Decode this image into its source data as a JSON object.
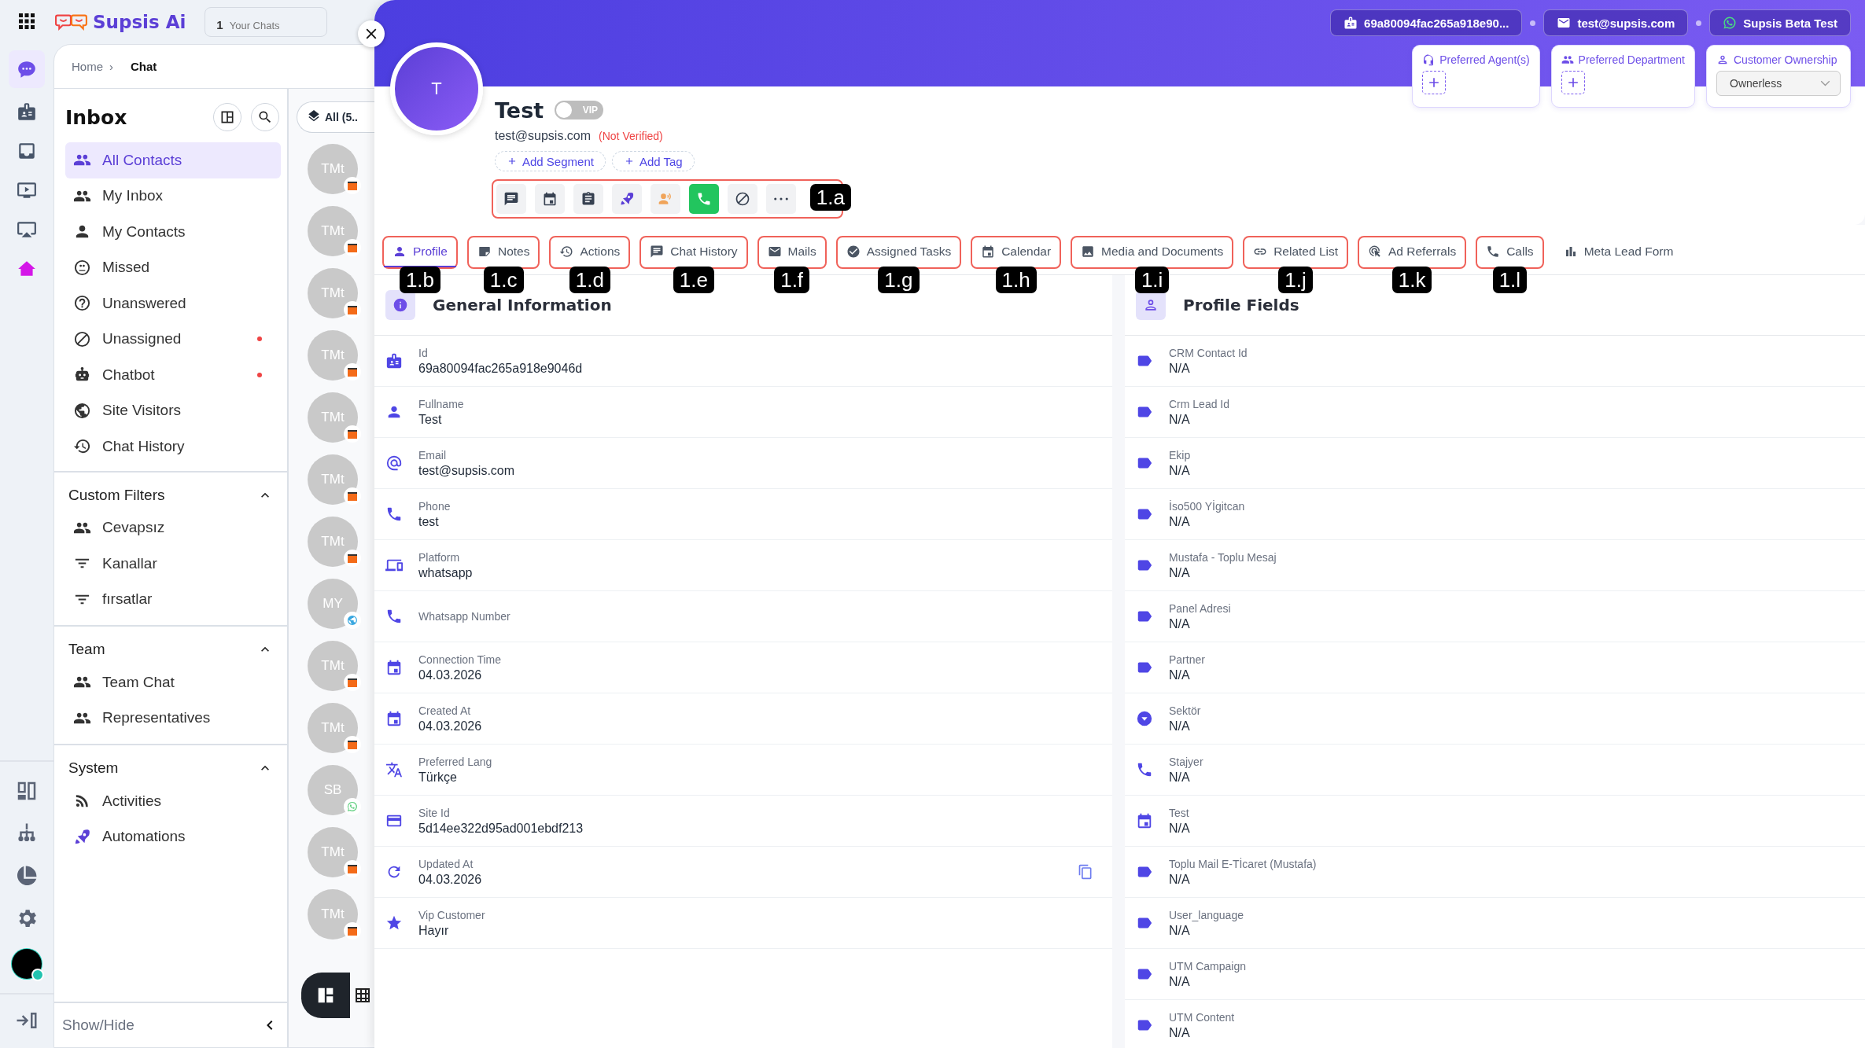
{
  "app": {
    "brand": "Supsis Ai",
    "chats_count": "1",
    "chats_label": "Your Chats"
  },
  "rail": [
    {
      "selected": true
    },
    {
      "selected": false
    },
    {
      "selected": false
    },
    {
      "selected": false
    },
    {
      "selected": false
    },
    {
      "selected": false
    }
  ],
  "user": {
    "online": true
  },
  "breadcrumb": {
    "home": "Home",
    "separator": "›",
    "current": "Chat"
  },
  "inbox": {
    "title": "Inbox",
    "items": [
      {
        "label": "All Contacts",
        "selected": true,
        "alert": false
      },
      {
        "label": "My Inbox",
        "selected": false,
        "alert": false
      },
      {
        "label": "My Contacts",
        "selected": false,
        "alert": false
      },
      {
        "label": "Missed",
        "selected": false,
        "alert": false
      },
      {
        "label": "Unanswered",
        "selected": false,
        "alert": false
      },
      {
        "label": "Unassigned",
        "selected": false,
        "alert": true
      },
      {
        "label": "Chatbot",
        "selected": false,
        "alert": true
      },
      {
        "label": "Site Visitors",
        "selected": false,
        "alert": false
      },
      {
        "label": "Chat History",
        "selected": false,
        "alert": false
      }
    ],
    "sections": [
      {
        "title": "Custom Filters",
        "expanded": true,
        "items": [
          "Cevapsız",
          "Kanallar",
          "fırsatlar"
        ]
      },
      {
        "title": "Team",
        "expanded": true,
        "items": [
          "Team Chat",
          "Representatives"
        ]
      },
      {
        "title": "System",
        "expanded": true,
        "items": [
          "Activities",
          "Automations"
        ]
      }
    ],
    "footer": "Show/Hide"
  },
  "chat_list": {
    "filter": "All (5..",
    "avatars": [
      {
        "initials": "TMt",
        "kind": "shop"
      },
      {
        "initials": "TMt",
        "kind": "shop"
      },
      {
        "initials": "TMt",
        "kind": "shop"
      },
      {
        "initials": "TMt",
        "kind": "shop"
      },
      {
        "initials": "TMt",
        "kind": "shop"
      },
      {
        "initials": "TMt",
        "kind": "shop"
      },
      {
        "initials": "TMt",
        "kind": "shop"
      },
      {
        "initials": "MY",
        "kind": "web"
      },
      {
        "initials": "TMt",
        "kind": "shop"
      },
      {
        "initials": "TMt",
        "kind": "shop"
      },
      {
        "initials": "SB",
        "kind": "whatsapp"
      },
      {
        "initials": "TMt",
        "kind": "shop"
      },
      {
        "initials": "TMt",
        "kind": "shop"
      }
    ]
  },
  "contact": {
    "avatar": "T",
    "name": "Test",
    "vip": false,
    "vip_label": "VIP",
    "email": "test@supsis.com",
    "verification": "(Not Verified)",
    "add_buttons": [
      "Add Segment",
      "Add Tag"
    ],
    "actions_callout": "1.a",
    "actions": [
      {
        "highlighted": false
      },
      {
        "highlighted": false
      },
      {
        "highlighted": false
      },
      {
        "highlighted": false
      },
      {
        "highlighted": false
      },
      {
        "highlighted": true
      },
      {
        "highlighted": false
      },
      {
        "highlighted": false
      }
    ],
    "chips": [
      "69a80094fac265a918e90...",
      "test@supsis.com",
      "Supsis Beta Test"
    ],
    "preferences": [
      {
        "label": "Preferred Agent(s)",
        "kind": "add"
      },
      {
        "label": "Preferred Department",
        "kind": "add"
      },
      {
        "label": "Customer Ownership",
        "kind": "select",
        "value": "Ownerless"
      }
    ]
  },
  "tabs": [
    {
      "label": "Profile",
      "selected": true,
      "callout": "1.b"
    },
    {
      "label": "Notes",
      "selected": false,
      "callout": "1.c"
    },
    {
      "label": "Actions",
      "selected": false,
      "callout": "1.d"
    },
    {
      "label": "Chat History",
      "selected": false,
      "callout": "1.e"
    },
    {
      "label": "Mails",
      "selected": false,
      "callout": "1.f"
    },
    {
      "label": "Assigned Tasks",
      "selected": false,
      "callout": "1.g"
    },
    {
      "label": "Calendar",
      "selected": false,
      "callout": "1.h"
    },
    {
      "label": "Media and Documents",
      "selected": false,
      "callout": "1.i"
    },
    {
      "label": "Related List",
      "selected": false,
      "callout": "1.j"
    },
    {
      "label": "Ad Referrals",
      "selected": false,
      "callout": "1.k"
    },
    {
      "label": "Calls",
      "selected": false,
      "callout": "1.l"
    },
    {
      "label": "Meta Lead Form",
      "selected": false
    }
  ],
  "general_information": {
    "title": "General Information",
    "fields": [
      {
        "label": "Id",
        "value": "69a80094fac265a918e9046d"
      },
      {
        "label": "Fullname",
        "value": "Test"
      },
      {
        "label": "Email",
        "value": "test@supsis.com"
      },
      {
        "label": "Phone",
        "value": "test"
      },
      {
        "label": "Platform",
        "value": "whatsapp"
      },
      {
        "label": "Whatsapp Number"
      },
      {
        "label": "Connection Time",
        "value": "04.03.2026"
      },
      {
        "label": "Created At",
        "value": "04.03.2026"
      },
      {
        "label": "Preferred Lang",
        "value": "Türkçe"
      },
      {
        "label": "Site Id",
        "value": "5d14ee322d95ad001ebdf213"
      },
      {
        "label": "Updated At",
        "value": "04.03.2026",
        "copyable": true
      },
      {
        "label": "Vip Customer",
        "value": "Hayır"
      }
    ]
  },
  "profile_fields": {
    "title": "Profile Fields",
    "fields": [
      {
        "label": "CRM Contact Id",
        "value": "N/A",
        "kind": "text"
      },
      {
        "label": "Crm Lead Id",
        "value": "N/A",
        "kind": "text"
      },
      {
        "label": "Ekip",
        "value": "N/A",
        "kind": "text"
      },
      {
        "label": "İso500 Yİgitcan",
        "value": "N/A",
        "kind": "text"
      },
      {
        "label": "Mustafa - Toplu Mesaj",
        "value": "N/A",
        "kind": "text"
      },
      {
        "label": "Panel Adresi",
        "value": "N/A",
        "kind": "text"
      },
      {
        "label": "Partner",
        "value": "N/A",
        "kind": "text"
      },
      {
        "label": "Sektör",
        "value": "N/A",
        "kind": "select"
      },
      {
        "label": "Stajyer",
        "value": "N/A",
        "kind": "phone"
      },
      {
        "label": "Test",
        "value": "N/A",
        "kind": "date"
      },
      {
        "label": "Toplu Mail E-Tİcaret (Mustafa)",
        "value": "N/A",
        "kind": "text"
      },
      {
        "label": "User_language",
        "value": "N/A",
        "kind": "text"
      },
      {
        "label": "UTM Campaign",
        "value": "N/A",
        "kind": "text"
      },
      {
        "label": "UTM Content",
        "value": "N/A",
        "kind": "text"
      }
    ]
  }
}
